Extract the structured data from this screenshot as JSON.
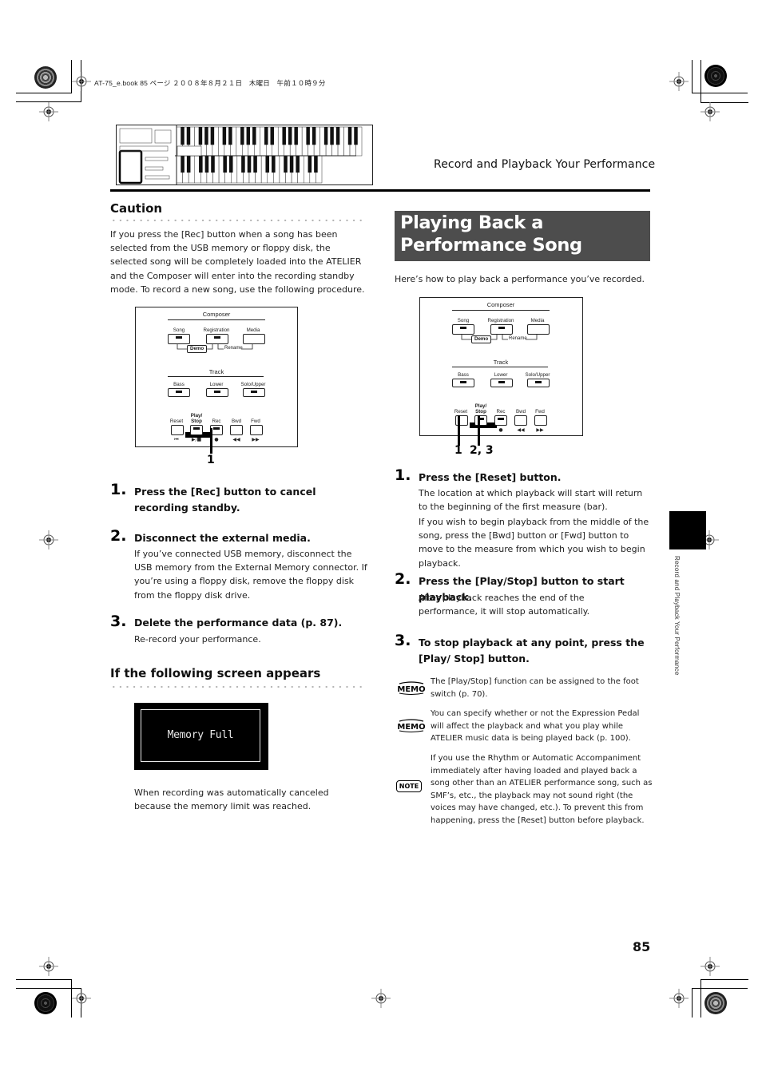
{
  "print_header": "AT-75_e.book  85 ページ  ２００８年８月２１日　木曜日　午前１０時９分",
  "running_head": "Record and Playback Your Performance",
  "side_tab_text": "Record and Playback Your Performance",
  "page_number": "85",
  "left_column": {
    "caution": {
      "heading": "Caution",
      "body": "If you press the [Rec] button when a song has been selected from the USB memory or floppy disk, the selected song will be completely loaded into the ATELIER and the Composer will enter into the recording standby mode. To record a new song, use the following procedure."
    },
    "steps": [
      {
        "num": "1.",
        "title": "Press the [Rec] button to cancel recording standby.",
        "body": ""
      },
      {
        "num": "2.",
        "title": "Disconnect the external media.",
        "body": "If you’ve connected USB memory, disconnect the USB memory from the External Memory connector. If you’re using a floppy disk, remove the floppy disk from the floppy disk drive."
      },
      {
        "num": "3.",
        "title": "Delete the performance data (p. 87).",
        "body": "Re-record your performance."
      }
    ],
    "screen_section": {
      "heading": "If the following screen appears",
      "lcd_text": "Memory Full",
      "body": "When recording was automatically canceled because the memory limit was reached."
    },
    "diagram_callouts": [
      "1"
    ]
  },
  "right_column": {
    "section_title": "Playing Back a Performance Song",
    "intro": "Here’s how to play back a performance you’ve recorded.",
    "diagram_callouts": [
      "1",
      "2, 3"
    ],
    "steps": [
      {
        "num": "1.",
        "title": "Press the [Reset] button.",
        "body": [
          "The location at which playback will start will return to the beginning of the first measure (bar).",
          "If you wish to begin playback from the middle of the song, press the [Bwd] button or [Fwd] button to move to the measure from which you wish to begin playback."
        ]
      },
      {
        "num": "2.",
        "title": "Press the [Play/Stop] button to start playback.",
        "body": [
          "After playback reaches the end of the performance, it will stop automatically."
        ]
      },
      {
        "num": "3.",
        "title": "To stop playback at any point, press the [Play/ Stop] button.",
        "body": []
      }
    ],
    "notes": [
      {
        "type": "memo",
        "icon_label": "MEMO",
        "text": "The [Play/Stop] function can be assigned to the foot switch (p. 70)."
      },
      {
        "type": "memo",
        "icon_label": "MEMO",
        "text": "You can specify whether or not the Expression Pedal will affect the playback and what you play while ATELIER music data is being played back (p. 100)."
      },
      {
        "type": "note",
        "icon_label": "NOTE",
        "text": "If you use the Rhythm or Automatic Accompaniment immediately after having loaded and played back a song other than an ATELIER performance song, such as SMF’s, etc., the playback may not sound right (the voices may have changed, etc.). To prevent this from happening, press the [Reset] button before playback."
      }
    ]
  },
  "panel_diagram": {
    "composer_title": "Composer",
    "composer_buttons": [
      "Song",
      "Registration",
      "Media"
    ],
    "composer_sub": [
      "Demo",
      "Rename"
    ],
    "track_title": "Track",
    "track_buttons": [
      "Bass",
      "Lower",
      "Solo/Upper"
    ],
    "transport_buttons": [
      "Reset",
      "Play/\nStop",
      "Rec",
      "Bwd",
      "Fwd"
    ],
    "transport_symbols": [
      "⏮",
      "▶/■",
      "●",
      "◀◀",
      "▶▶"
    ]
  }
}
